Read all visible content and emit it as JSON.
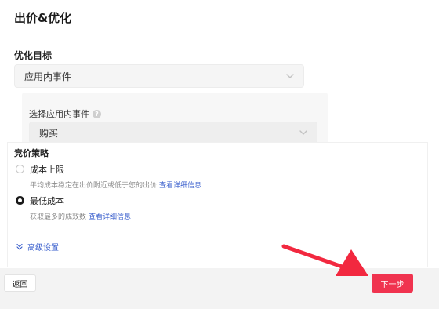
{
  "header": {
    "title": "出价&优化"
  },
  "optimization_goal": {
    "label": "优化目标",
    "selected": "应用内事件"
  },
  "app_event": {
    "label": "选择应用内事件",
    "help_icon": "?",
    "selected": "购买"
  },
  "bid_strategy": {
    "title": "竞价策略",
    "options": [
      {
        "label": "成本上限",
        "description": "平均成本稳定在出价附近或低于您的出价",
        "link": "查看详细信息",
        "checked": false
      },
      {
        "label": "最低成本",
        "description": "获取最多的成效数",
        "link": "查看详细信息",
        "checked": true
      }
    ]
  },
  "advanced": {
    "label": "高级设置"
  },
  "footer": {
    "back_label": "返回",
    "next_label": "下一步"
  },
  "colors": {
    "primary": "#f0334f",
    "link": "#3a5fcd",
    "annotation_arrow": "#f2283f"
  },
  "icons": {
    "select_caret": "chevron-down-icon",
    "advanced": "double-chevron-down-icon",
    "help": "question-circle-icon"
  }
}
